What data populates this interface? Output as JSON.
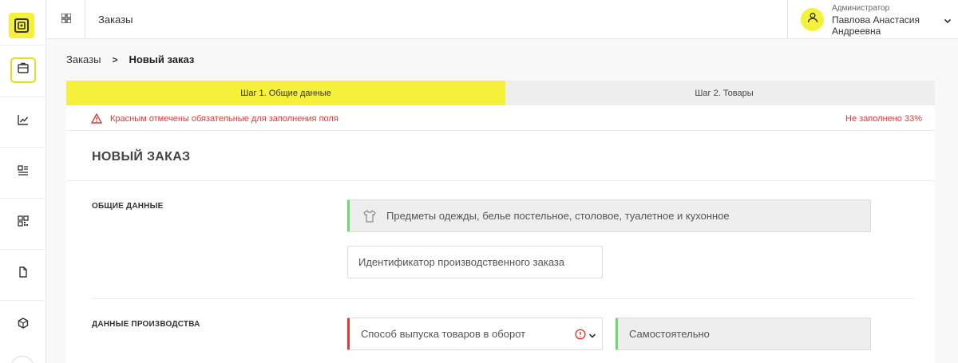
{
  "header": {
    "title": "Заказы",
    "user": {
      "role": "Администратор",
      "name": "Павлова Анастасия Андреевна"
    }
  },
  "sidebar": {
    "icons": [
      "logo-icon",
      "briefcase-icon",
      "chart-icon",
      "list-icon",
      "qr-code-icon",
      "document-icon",
      "box-icon"
    ]
  },
  "breadcrumb": {
    "parent": "Заказы",
    "separator": ">",
    "current": "Новый заказ"
  },
  "stepper": {
    "step1": "Шаг 1. Общие данные",
    "step2": "Шаг 2. Товары"
  },
  "alert": {
    "message": "Красным отмечены обязательные для заполнения поля",
    "progress": "Не заполнено 33%"
  },
  "form": {
    "title": "НОВЫЙ ЗАКАЗ",
    "general": {
      "label": "ОБЩИЕ ДАННЫЕ",
      "category": "Предметы одежды, белье постельное, столовое, туалетное и кухонное",
      "order_id_placeholder": "Идентификатор производственного заказа"
    },
    "production": {
      "label": "ДАННЫЕ ПРОИЗВОДСТВА",
      "method_placeholder": "Способ выпуска товаров в оборот",
      "method_mode": "Самостоятельно"
    }
  },
  "colors": {
    "accent": "#f5f03a",
    "error": "#e53935",
    "ok": "#6bd96b"
  }
}
